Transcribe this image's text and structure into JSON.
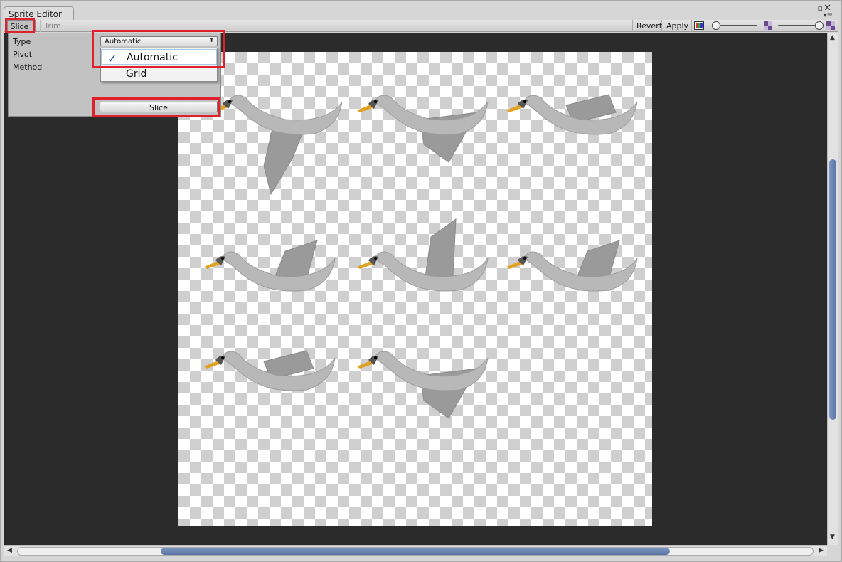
{
  "window": {
    "title": "Sprite Editor",
    "maximize_glyph": "▫",
    "close_glyph": "✕",
    "menu_glyph": "▾≡"
  },
  "toolbar": {
    "slice_label": "Slice",
    "trim_label": "Trim",
    "revert_label": "Revert",
    "apply_label": "Apply"
  },
  "slice_panel": {
    "type_label": "Type",
    "pivot_label": "Pivot",
    "method_label": "Method",
    "type_value": "Automatic",
    "type_options": [
      "Automatic",
      "Grid"
    ],
    "selected_option": "Automatic",
    "check_glyph": "✓",
    "slice_button_label": "Slice"
  },
  "sprite_sheet": {
    "sprites": [
      {
        "pose": "wing-down"
      },
      {
        "pose": "wing-mid-low"
      },
      {
        "pose": "wing-folded"
      },
      {
        "pose": "wing-up-mid"
      },
      {
        "pose": "wing-up-high"
      },
      {
        "pose": "wing-up-mid"
      },
      {
        "pose": "wing-folded"
      },
      {
        "pose": "wing-mid-low"
      }
    ]
  },
  "highlight_color": "#e0202a",
  "icons": {
    "color_channel": "color-channel-icon",
    "mipmap": "mipmap-icon",
    "alpha": "alpha-icon"
  }
}
